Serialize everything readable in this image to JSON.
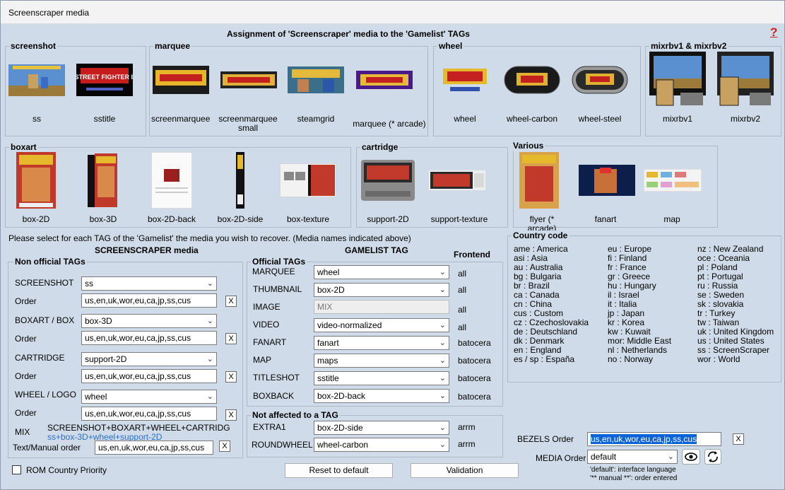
{
  "window": {
    "title": "Screenscraper media"
  },
  "header": {
    "title": "Assignment of 'Screenscraper' media to the 'Gamelist' TAGs",
    "help": "?"
  },
  "groups": {
    "screenshot": {
      "label": "screenshot",
      "items": [
        "ss",
        "sstitle"
      ]
    },
    "marquee": {
      "label": "marquee",
      "items": [
        "screenmarquee",
        "screenmarquee small",
        "steamgrid",
        "marquee (* arcade)"
      ]
    },
    "wheel": {
      "label": "wheel",
      "items": [
        "wheel",
        "wheel-carbon",
        "wheel-steel"
      ]
    },
    "mixrbv": {
      "label": "mixrbv1 & mixrbv2",
      "items": [
        "mixrbv1",
        "mixrbv2"
      ]
    },
    "boxart": {
      "label": "boxart",
      "items": [
        "box-2D",
        "box-3D",
        "box-2D-back",
        "box-2D-side",
        "box-texture"
      ]
    },
    "cartridge": {
      "label": "cartridge",
      "items": [
        "support-2D",
        "support-texture"
      ]
    },
    "various": {
      "label": "Various",
      "items": [
        "flyer (* arcade)",
        "fanart",
        "map"
      ]
    }
  },
  "thumb_art": {
    "sf2_text": "STREET FIGHTER II",
    "sf2_short": "II"
  },
  "instructions": "Please select for each TAG of the 'Gamelist' the media you wish to recover. (Media names indicated above)",
  "ss_media": {
    "title": "SCREENSCRAPER media",
    "group_label": "Non official TAGs",
    "rows": [
      {
        "label": "SCREENSHOT",
        "value": "ss",
        "order": "us,en,uk,wor,eu,ca,jp,ss,cus"
      },
      {
        "label": "BOXART / BOX",
        "value": "box-3D",
        "order": "us,en,uk,wor,eu,ca,jp,ss,cus"
      },
      {
        "label": "CARTRIDGE",
        "value": "support-2D",
        "order": "us,en,uk,wor,eu,ca,jp,ss,cus"
      },
      {
        "label": "WHEEL / LOGO",
        "value": "wheel",
        "order": "us,en,uk,wor,eu,ca,jp,ss,cus"
      }
    ],
    "order_label": "Order",
    "mix_label": "MIX",
    "mix_value": "SCREENSHOT+BOXART+WHEEL+CARTRIDG",
    "mix_sub": "ss+box-3D+wheel+support-2D",
    "text_manual_label": "Text/Manual order",
    "text_manual_value": "us,en,uk,wor,eu,ca,jp,ss,cus",
    "clear": "X"
  },
  "gamelist": {
    "title": "GAMELIST TAG",
    "frontend_title": "Frontend",
    "official_label": "Official TAGs",
    "rows": [
      {
        "label": "MARQUEE",
        "value": "wheel",
        "frontend": "all"
      },
      {
        "label": "THUMBNAIL",
        "value": "box-2D",
        "frontend": "all"
      },
      {
        "label": "IMAGE",
        "value": "MIX",
        "frontend": "all",
        "disabled": true
      },
      {
        "label": "VIDEO",
        "value": "video-normalized",
        "frontend": "all"
      },
      {
        "label": "FANART",
        "value": "fanart",
        "frontend": "batocera"
      },
      {
        "label": "MAP",
        "value": "maps",
        "frontend": "batocera"
      },
      {
        "label": "TITLESHOT",
        "value": "sstitle",
        "frontend": "batocera"
      },
      {
        "label": "BOXBACK",
        "value": "box-2D-back",
        "frontend": "batocera"
      }
    ],
    "not_affected_label": "Not affected to a TAG",
    "extra_rows": [
      {
        "label": "EXTRA1",
        "value": "box-2D-side",
        "frontend": "arrm"
      },
      {
        "label": "ROUNDWHEEL",
        "value": "wheel-carbon",
        "frontend": "arrm"
      }
    ]
  },
  "country": {
    "label": "Country code",
    "col1": [
      "ame : America",
      "asi : Asia",
      "au : Australia",
      "bg : Bulgaria",
      "br : Brazil",
      "ca : Canada",
      "cn : China",
      "cus : Custom",
      "cz : Czechoslovakia",
      "de : Deutschland",
      "dk : Denmark",
      "en : England",
      "es / sp : España"
    ],
    "col2": [
      "eu : Europe",
      "fi : Finland",
      "fr : France",
      "gr : Greece",
      "hu : Hungary",
      "il : Israel",
      "it : Italia",
      "jp : Japan",
      "kr : Korea",
      "kw : Kuwait",
      "mor: Middle East",
      "nl : Netherlands",
      "no : Norway"
    ],
    "col3": [
      "nz : New Zealand",
      "oce : Oceania",
      "pl : Poland",
      "pt : Portugal",
      "ru : Russia",
      "se : Sweden",
      "sk : slovakia",
      "tr : Turkey",
      "tw : Taiwan",
      "uk : United Kingdom",
      "us : United States",
      "ss : ScreenScraper",
      "wor : World"
    ]
  },
  "bezels": {
    "label": "BEZELS Order",
    "value": "us,en,uk,wor,eu,ca,jp,ss,cus",
    "clear": "X"
  },
  "media_order": {
    "label": "MEDIA Order",
    "value": "default",
    "note1": "'default': interface language",
    "note2": "'** manual **': order entered"
  },
  "footer": {
    "rom_country": "ROM Country Priority",
    "reset": "Reset to default",
    "validation": "Validation"
  }
}
